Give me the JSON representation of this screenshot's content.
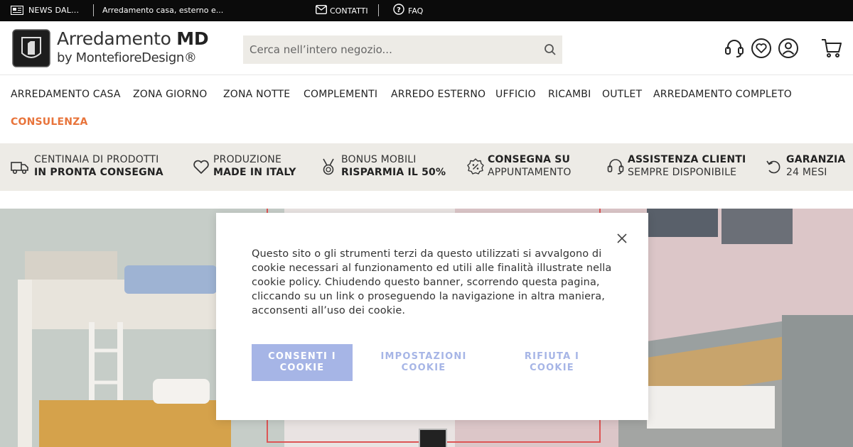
{
  "topbar": {
    "news_label": "NEWS DAL...",
    "ticker_text": "Arredamento casa, esterno e...",
    "contact_label": "CONTATTI",
    "faq_label": "FAQ"
  },
  "brand": {
    "name_main": "Arredamento ",
    "name_bold": "MD",
    "subline": "by MontefioreDesign®"
  },
  "search": {
    "placeholder": "Cerca nell’intero negozio..."
  },
  "header_icons": [
    "support-headset-icon",
    "heart-icon",
    "user-icon",
    "cart-icon"
  ],
  "nav": {
    "items": [
      "ARREDAMENTO CASA",
      "ZONA GIORNO",
      "ZONA NOTTE",
      "COMPLEMENTI",
      "ARREDO ESTERNO",
      "UFFICIO",
      "RICAMBI",
      "OUTLET",
      "ARREDAMENTO COMPLETO"
    ],
    "highlight": "CONSULENZA",
    "highlight_color": "#e8743b"
  },
  "usp": [
    {
      "icon": "truck-icon",
      "line1": "CENTINAIA DI PRODOTTI",
      "line2": "IN PRONTA CONSEGNA",
      "bold_line": 2
    },
    {
      "icon": "heart-icon",
      "line1": "PRODUZIONE",
      "line2": "MADE IN ITALY",
      "bold_line": 2
    },
    {
      "icon": "medal-icon",
      "line1": "BONUS MOBILI",
      "line2": "RISPARMIA IL 50%",
      "bold_line": 2
    },
    {
      "icon": "percent-badge-icon",
      "line1": "CONSEGNA SU",
      "line2": "APPUNTAMENTO",
      "bold_line": 1
    },
    {
      "icon": "headset-icon",
      "line1": "ASSISTENZA CLIENTI",
      "line2": "SEMPRE DISPONIBILE",
      "bold_line": 1
    },
    {
      "icon": "undo-arrow-icon",
      "line1": "GARANZIA",
      "line2": "24 MESI",
      "bold_line": 1
    }
  ],
  "cookie_banner": {
    "text": "Questo sito o gli strumenti terzi da questo utilizzati si avvalgono di cookie necessari al funzionamento ed utili alle finalità illustrate nella cookie policy. Chiudendo questo banner, scorrendo questa pagina, cliccando su un link o proseguendo la navigazione in altra maniera, acconsenti all’uso dei cookie.",
    "accept_label": "CONSENTI I COOKIE",
    "settings_label": "IMPOSTAZIONI COOKIE",
    "reject_label": "RIFIUTA I COOKIE",
    "accent_color": "#a6b5e6"
  }
}
